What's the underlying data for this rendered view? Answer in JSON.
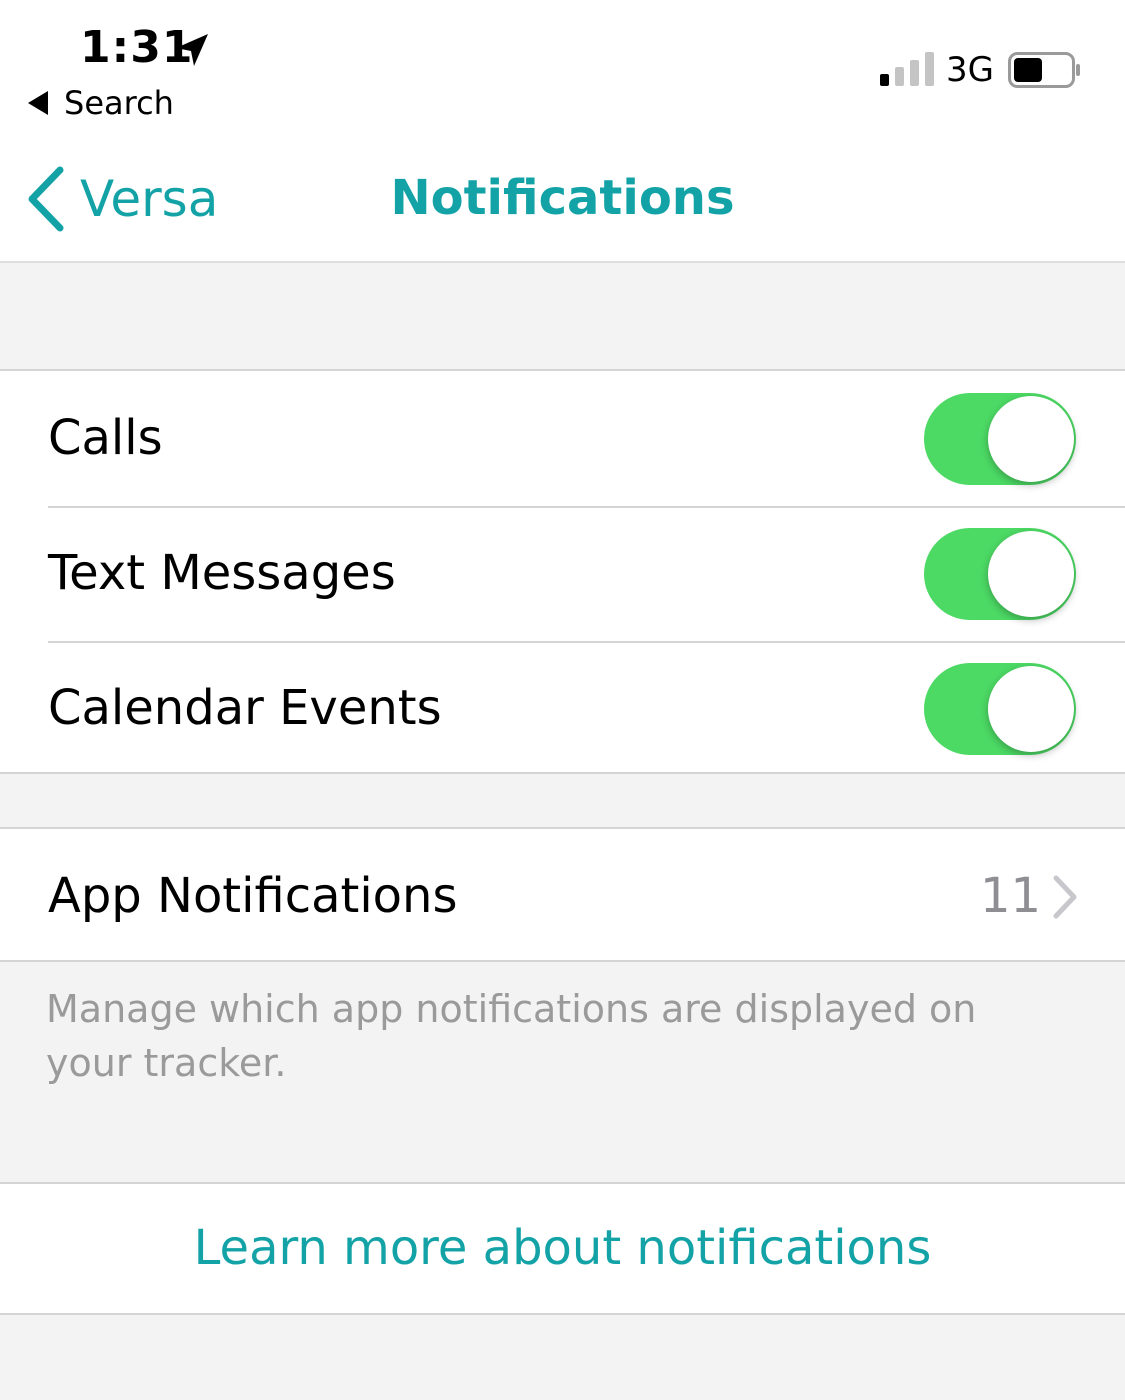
{
  "status_bar": {
    "time": "1:31",
    "back_app": "Search",
    "network": "3G",
    "signal_bars_filled": 1,
    "signal_bars_total": 4,
    "battery_level": 0.5
  },
  "nav": {
    "back_label": "Versa",
    "title": "Notifications",
    "accent_color": "#13a3a7"
  },
  "toggles": [
    {
      "label": "Calls",
      "on": true
    },
    {
      "label": "Text Messages",
      "on": true
    },
    {
      "label": "Calendar Events",
      "on": true
    }
  ],
  "app_notifications": {
    "label": "App Notifications",
    "count": "11",
    "footnote": "Manage which app notifications are displayed on your tracker."
  },
  "learn_more": {
    "label": "Learn more about notifications"
  },
  "colors": {
    "toggle_on": "#4cd964",
    "background": "#f3f3f3"
  }
}
